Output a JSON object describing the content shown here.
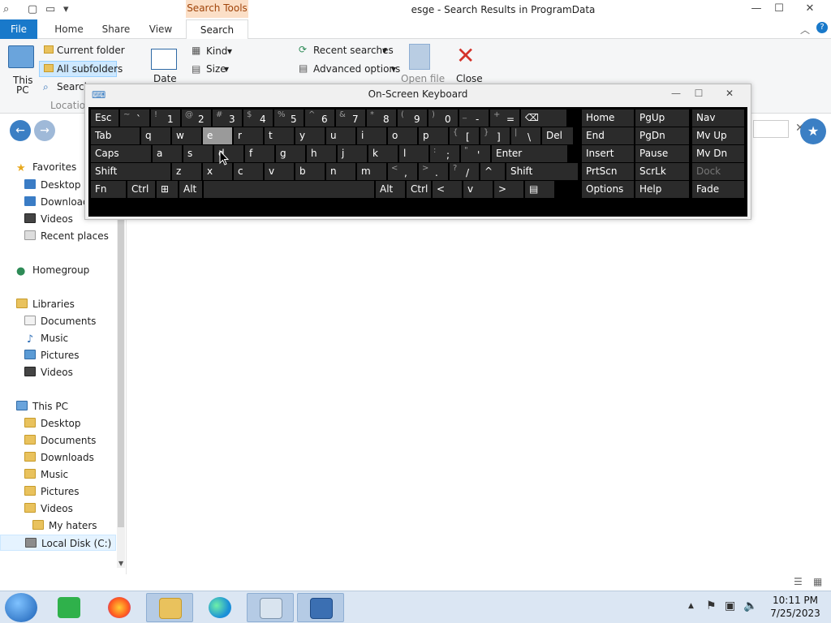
{
  "window": {
    "title": "esge - Search Results in ProgramData",
    "contextual_tab": "Search Tools",
    "min": "—",
    "max": "☐",
    "close": "✕"
  },
  "tabs": {
    "file": "File",
    "home": "Home",
    "share": "Share",
    "view": "View",
    "search": "Search"
  },
  "ribbon": {
    "this_pc_line1": "This",
    "this_pc_line2": "PC",
    "current_folder": "Current folder",
    "all_subfolders": "All subfolders",
    "search_again": "Search",
    "location_group": "Locatio",
    "date": "Date",
    "kind": "Kind",
    "size": "Size",
    "recent_searches": "Recent searches",
    "advanced_options": "Advanced options",
    "open_file": "Open file",
    "close": "Close"
  },
  "osk": {
    "title": "On-Screen Keyboard",
    "rows": [
      [
        {
          "label": "Esc"
        },
        {
          "sub": "~",
          "main": "`"
        },
        {
          "sub": "!",
          "main": "1"
        },
        {
          "sub": "@",
          "main": "2"
        },
        {
          "sub": "#",
          "main": "3"
        },
        {
          "sub": "$",
          "main": "4"
        },
        {
          "sub": "%",
          "main": "5"
        },
        {
          "sub": "^",
          "main": "6"
        },
        {
          "sub": "&",
          "main": "7"
        },
        {
          "sub": "*",
          "main": "8"
        },
        {
          "sub": "(",
          "main": "9"
        },
        {
          "sub": ")",
          "main": "0"
        },
        {
          "sub": "_",
          "main": "-"
        },
        {
          "sub": "+",
          "main": "="
        },
        {
          "label": "⌫"
        }
      ],
      [
        {
          "label": "Tab"
        },
        {
          "label": "q"
        },
        {
          "label": "w"
        },
        {
          "label": "e"
        },
        {
          "label": "r"
        },
        {
          "label": "t"
        },
        {
          "label": "y"
        },
        {
          "label": "u"
        },
        {
          "label": "i"
        },
        {
          "label": "o"
        },
        {
          "label": "p"
        },
        {
          "sub": "{",
          "main": "["
        },
        {
          "sub": "}",
          "main": "]"
        },
        {
          "sub": "|",
          "main": "\\"
        },
        {
          "label": "Del"
        }
      ],
      [
        {
          "label": "Caps"
        },
        {
          "label": "a"
        },
        {
          "label": "s"
        },
        {
          "label": "d"
        },
        {
          "label": "f"
        },
        {
          "label": "g"
        },
        {
          "label": "h"
        },
        {
          "label": "j"
        },
        {
          "label": "k"
        },
        {
          "label": "l"
        },
        {
          "sub": ":",
          "main": ";"
        },
        {
          "sub": "\"",
          "main": "'"
        },
        {
          "label": "Enter"
        }
      ],
      [
        {
          "label": "Shift"
        },
        {
          "label": "z"
        },
        {
          "label": "x"
        },
        {
          "label": "c"
        },
        {
          "label": "v"
        },
        {
          "label": "b"
        },
        {
          "label": "n"
        },
        {
          "label": "m"
        },
        {
          "sub": "<",
          "main": ","
        },
        {
          "sub": ">",
          "main": "."
        },
        {
          "sub": "?",
          "main": "/"
        },
        {
          "label": "^"
        },
        {
          "label": "Shift"
        }
      ],
      [
        {
          "label": "Fn"
        },
        {
          "label": "Ctrl"
        },
        {
          "label": "⊞"
        },
        {
          "label": "Alt"
        },
        {
          "label": ""
        },
        {
          "label": "Alt"
        },
        {
          "label": "Ctrl"
        },
        {
          "label": "<"
        },
        {
          "label": "v"
        },
        {
          "label": ">"
        },
        {
          "label": "▤"
        }
      ]
    ],
    "nav": [
      [
        "Home",
        "PgUp",
        "Nav"
      ],
      [
        "End",
        "PgDn",
        "Mv Up"
      ],
      [
        "Insert",
        "Pause",
        "Mv Dn"
      ],
      [
        "PrtScn",
        "ScrLk",
        "Dock"
      ],
      [
        "Options",
        "Help",
        "Fade"
      ]
    ]
  },
  "nav_pane": [
    {
      "label": "Favorites",
      "icon": "star-icon"
    },
    {
      "label": "Desktop",
      "icon": "desktop-icon"
    },
    {
      "label": "Downloads",
      "icon": "downloads-icon"
    },
    {
      "label": "Videos",
      "icon": "videos-icon"
    },
    {
      "label": "Recent places",
      "icon": "recent-places-icon"
    },
    {
      "label": "Homegroup",
      "icon": "homegroup-icon"
    },
    {
      "label": "Libraries",
      "icon": "libraries-icon"
    },
    {
      "label": "Documents",
      "icon": "documents-icon"
    },
    {
      "label": "Music",
      "icon": "music-icon"
    },
    {
      "label": "Pictures",
      "icon": "pictures-icon"
    },
    {
      "label": "Videos",
      "icon": "videos-icon"
    },
    {
      "label": "This PC",
      "icon": "this-pc-icon"
    },
    {
      "label": "Desktop",
      "icon": "desktop-icon"
    },
    {
      "label": "Documents",
      "icon": "documents-icon"
    },
    {
      "label": "Downloads",
      "icon": "downloads-icon"
    },
    {
      "label": "Music",
      "icon": "music-icon"
    },
    {
      "label": "Pictures",
      "icon": "pictures-icon"
    },
    {
      "label": "Videos",
      "icon": "videos-icon"
    },
    {
      "label": "My haters",
      "icon": "folder-icon"
    },
    {
      "label": "Local Disk (C:)",
      "icon": "local-disk-icon"
    }
  ],
  "clock": {
    "time": "10:11 PM",
    "date": "7/25/2023"
  }
}
